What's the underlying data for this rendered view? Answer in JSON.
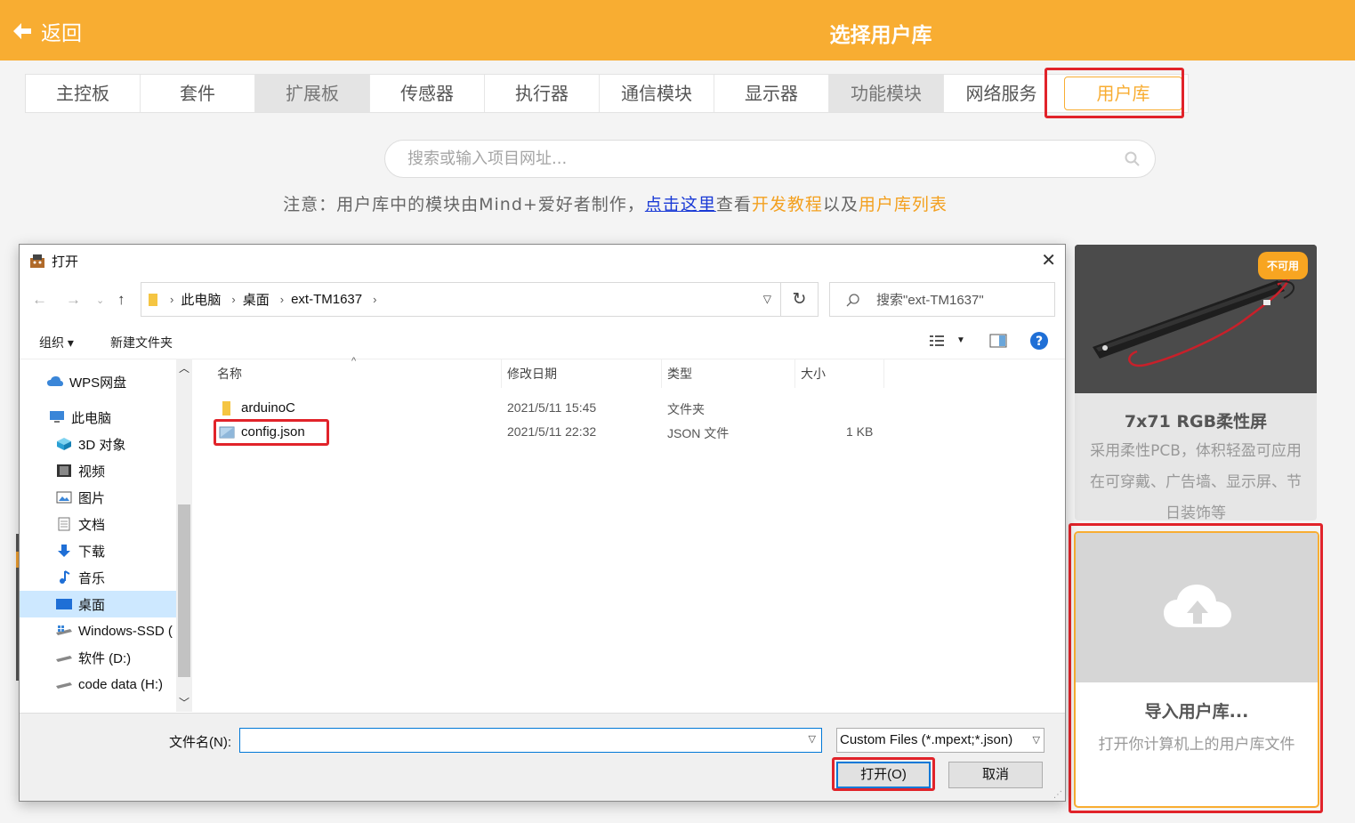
{
  "header": {
    "back_label": "返回",
    "title": "选择用户库"
  },
  "tabs": [
    "主控板",
    "套件",
    "扩展板",
    "传感器",
    "执行器",
    "通信模块",
    "显示器",
    "功能模块",
    "网络服务",
    "用户库"
  ],
  "search": {
    "placeholder": "搜索或输入项目网址..."
  },
  "notice": {
    "prefix": "注意：用户库中的模块由Mind+爱好者制作，",
    "link": "点击这里",
    "mid1": "查看",
    "tutorial": "开发教程",
    "mid2": "以及",
    "list": "用户库列表"
  },
  "card_rgb": {
    "badge": "不可用",
    "name": "7x71 RGB柔性屏",
    "desc": "采用柔性PCB，体积轻盈可应用在可穿戴、广告墙、显示屏、节日装饰等"
  },
  "card_import": {
    "title": "导入用户库...",
    "subtitle": "打开你计算机上的用户库文件"
  },
  "dialog": {
    "title": "打开",
    "breadcrumb": [
      "此电脑",
      "桌面",
      "ext-TM1637"
    ],
    "search_placeholder": "搜索\"ext-TM1637\"",
    "toolbar": {
      "organize": "组织 ▾",
      "new_folder": "新建文件夹"
    },
    "nav_items": [
      {
        "label": "WPS网盘",
        "icon": "cloud-icon"
      },
      {
        "label": "此电脑",
        "icon": "computer-icon"
      },
      {
        "label": "3D 对象",
        "icon": "3d-objects-icon"
      },
      {
        "label": "视频",
        "icon": "video-icon"
      },
      {
        "label": "图片",
        "icon": "pictures-icon"
      },
      {
        "label": "文档",
        "icon": "documents-icon"
      },
      {
        "label": "下载",
        "icon": "download-icon"
      },
      {
        "label": "音乐",
        "icon": "music-icon"
      },
      {
        "label": "桌面",
        "icon": "desktop-icon"
      },
      {
        "label": "Windows-SSD (",
        "icon": "drive-icon"
      },
      {
        "label": "软件 (D:)",
        "icon": "drive-icon"
      },
      {
        "label": "code data (H:)",
        "icon": "drive-icon"
      }
    ],
    "columns": [
      "名称",
      "修改日期",
      "类型",
      "大小"
    ],
    "files": [
      {
        "name": "arduinoC",
        "date": "2021/5/11 15:45",
        "type": "文件夹",
        "size": ""
      },
      {
        "name": "config.json",
        "date": "2021/5/11 22:32",
        "type": "JSON 文件",
        "size": "1 KB"
      }
    ],
    "filename_label": "文件名(N):",
    "filename_value": "",
    "filetype": "Custom Files (*.mpext;*.json)",
    "open_label": "打开(O)",
    "cancel_label": "取消"
  },
  "colors": {
    "accent": "#f8ad32",
    "highlight": "#e1232a"
  }
}
